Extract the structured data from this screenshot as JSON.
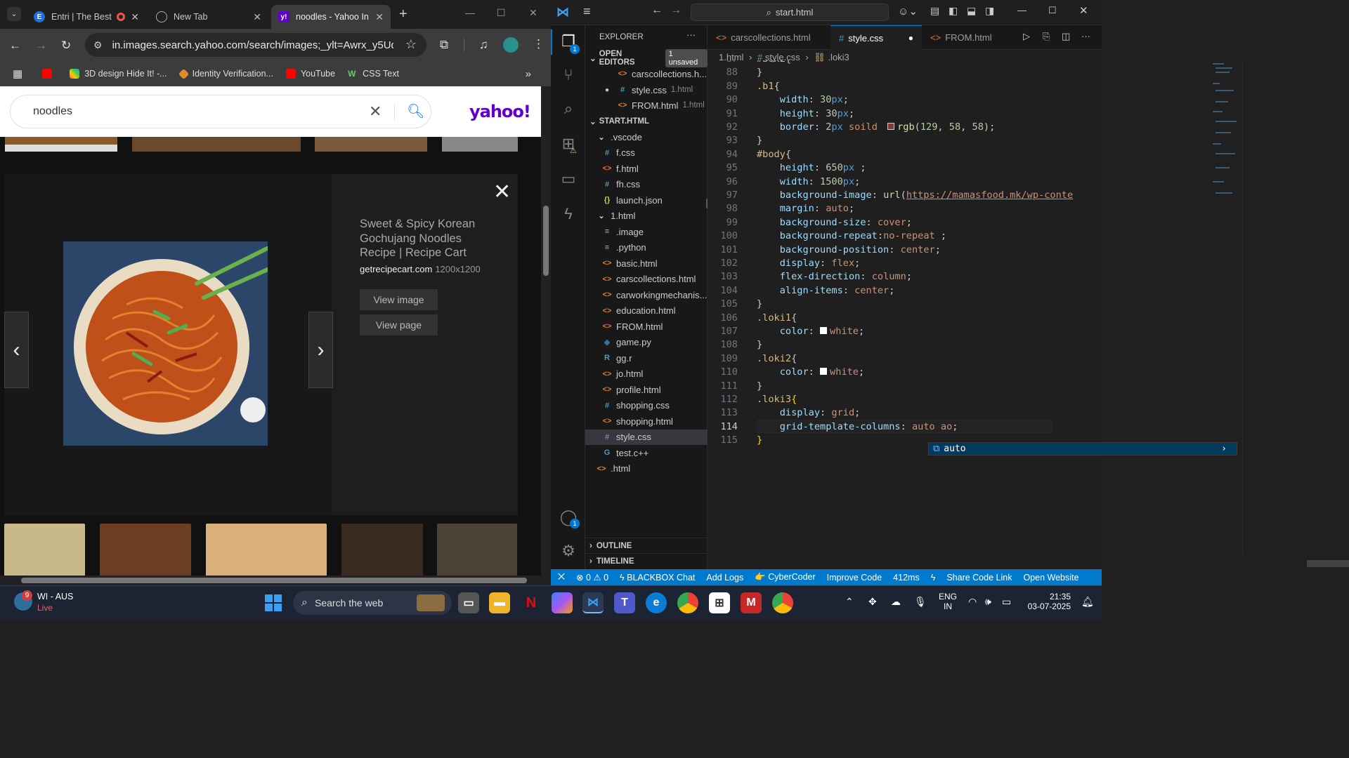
{
  "chrome": {
    "tabs": [
      {
        "title": "Entri | The Best"
      },
      {
        "title": "New Tab"
      },
      {
        "title": "noodles - Yahoo In"
      }
    ],
    "url": "in.images.search.yahoo.com/search/images;_ylt=Awrx_y5UqW...",
    "bookmarks": [
      "3D design Hide It! -...",
      "Identity Verification...",
      "YouTube",
      "CSS Text"
    ]
  },
  "yahoo": {
    "query": "noodles",
    "logo": "yahoo!",
    "preview": {
      "title": "Sweet & Spicy Korean Gochujang Noodles Recipe | Recipe Cart",
      "source": "getrecipecart.com",
      "dimensions": "1200x1200",
      "view_image": "View image",
      "view_page": "View page"
    }
  },
  "vscode": {
    "search": "start.html",
    "explorer_title": "EXPLORER",
    "open_editors_label": "OPEN EDITORS",
    "unsaved": "1 unsaved",
    "open_editors": [
      {
        "name": "carscollections.h...",
        "hint": ""
      },
      {
        "name": "style.css",
        "hint": "1.html"
      },
      {
        "name": "FROM.html",
        "hint": "1.html"
      }
    ],
    "workspace": "START.HTML",
    "tree": [
      ".vscode",
      "f.css",
      "f.html",
      "fh.css",
      "launch.json",
      "1.html",
      ".image",
      ".python",
      "basic.html",
      "carscollections.html",
      "carworkingmechanis...",
      "education.html",
      "FROM.html",
      "game.py",
      "gg.r",
      "jo.html",
      "profile.html",
      "shopping.css",
      "shopping.html",
      "style.css",
      "test.c++",
      ".html"
    ],
    "outline": "OUTLINE",
    "timeline": "TIMELINE",
    "tabs": [
      "carscollections.html",
      "style.css",
      "FROM.html"
    ],
    "breadcrumb": [
      "1.html",
      "style.css",
      ".loki3"
    ],
    "suggestion": "auto",
    "status": {
      "errors": "0",
      "warnings": "0",
      "items": [
        "BLACKBOX Chat",
        "Add Logs",
        "CyberCoder",
        "Improve Code",
        "412ms",
        "Share Code Link",
        "Open Website"
      ]
    }
  },
  "taskbar": {
    "weather_title": "WI - AUS",
    "weather_sub": "Live",
    "weather_badge": "9",
    "search": "Search the web",
    "lang1": "ENG",
    "lang2": "IN",
    "time": "21:35",
    "date": "03-07-2025"
  }
}
